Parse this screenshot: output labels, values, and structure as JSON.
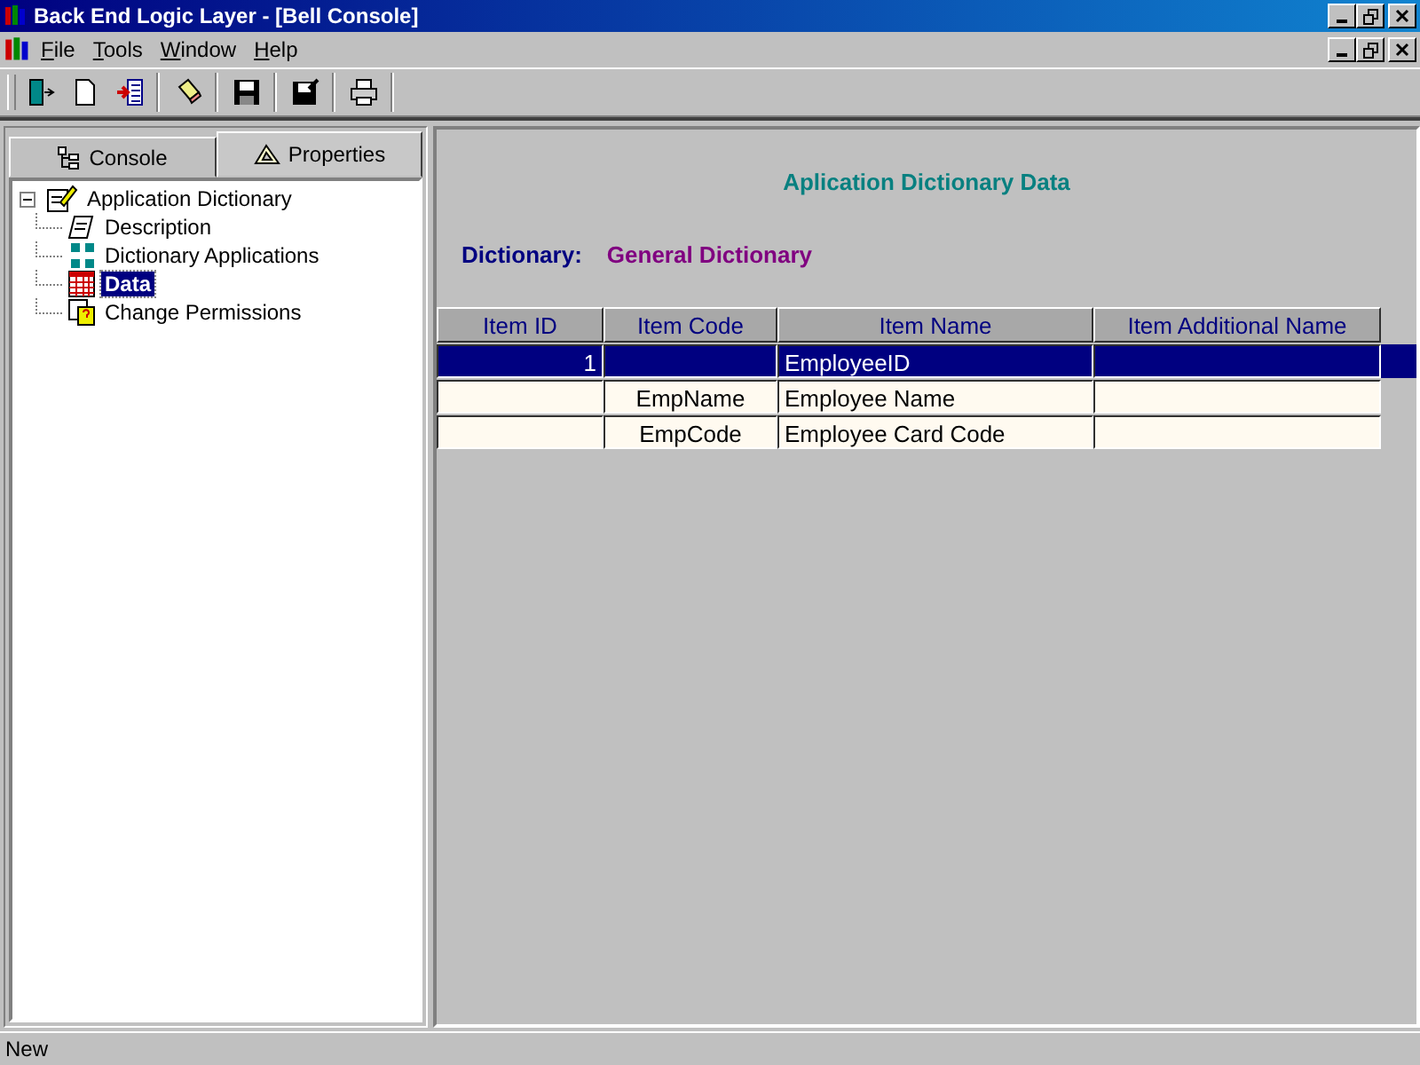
{
  "window": {
    "title": "Back End Logic Layer - [Bell Console]"
  },
  "menu": [
    {
      "label": "File"
    },
    {
      "label": "Tools"
    },
    {
      "label": "Window"
    },
    {
      "label": "Help"
    }
  ],
  "tabs": [
    {
      "label": "Console",
      "selected": false
    },
    {
      "label": "Properties",
      "selected": true
    }
  ],
  "tree": [
    {
      "label": "Application Dictionary",
      "expanded": true,
      "selected": false,
      "children": [
        {
          "label": "Description",
          "selected": false
        },
        {
          "label": "Dictionary Applications",
          "selected": false
        },
        {
          "label": "Data",
          "selected": true
        },
        {
          "label": "Change Permissions",
          "selected": false
        }
      ]
    }
  ],
  "panel": {
    "title": "Aplication Dictionary Data",
    "dictionary_label": "Dictionary:",
    "dictionary_value": "General Dictionary"
  },
  "table": {
    "columns": [
      "Item ID",
      "Item Code",
      "Item Name",
      "Item Additional Name"
    ],
    "rows": [
      {
        "cells": [
          "1",
          "",
          "EmployeeID",
          ""
        ],
        "selected": true
      },
      {
        "cells": [
          "",
          "EmpName",
          "Employee Name",
          ""
        ],
        "selected": false
      },
      {
        "cells": [
          "",
          "EmpCode",
          "Employee Card Code",
          ""
        ],
        "selected": false
      }
    ]
  },
  "status_bar": {
    "text": "New"
  }
}
